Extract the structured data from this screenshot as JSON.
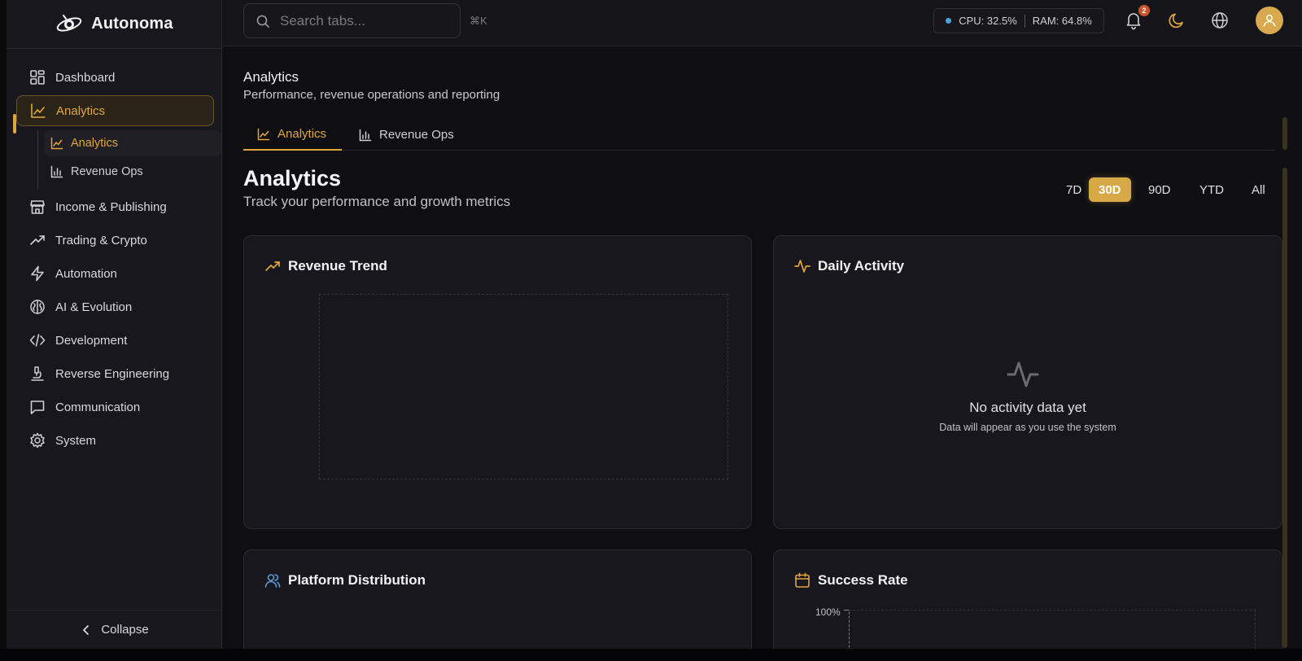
{
  "app": {
    "name": "Autonoma"
  },
  "sidebar": {
    "items": [
      {
        "label": "Dashboard",
        "icon": "dashboard-icon"
      },
      {
        "label": "Analytics",
        "icon": "line-chart-icon",
        "active": true
      },
      {
        "label": "Income & Publishing",
        "icon": "store-icon"
      },
      {
        "label": "Trading & Crypto",
        "icon": "trending-up-icon"
      },
      {
        "label": "Automation",
        "icon": "lightning-icon"
      },
      {
        "label": "AI & Evolution",
        "icon": "brain-icon"
      },
      {
        "label": "Development",
        "icon": "code-icon"
      },
      {
        "label": "Reverse Engineering",
        "icon": "microscope-icon"
      },
      {
        "label": "Communication",
        "icon": "message-icon"
      },
      {
        "label": "System",
        "icon": "gear-icon"
      }
    ],
    "subitems": [
      {
        "label": "Analytics",
        "icon": "line-chart-icon",
        "active": true
      },
      {
        "label": "Revenue Ops",
        "icon": "bar-chart-icon"
      }
    ],
    "collapse_label": "Collapse"
  },
  "topbar": {
    "search_placeholder": "Search tabs...",
    "shortcut": "⌘K",
    "cpu": "CPU: 32.5%",
    "ram": "RAM: 64.8%",
    "notification_count": "2",
    "accent_color": "#e3a63d"
  },
  "page": {
    "header_title": "Analytics",
    "header_subtitle": "Performance, revenue operations and reporting",
    "tabs": [
      {
        "label": "Analytics",
        "active": true
      },
      {
        "label": "Revenue Ops",
        "active": false
      }
    ],
    "title": "Analytics",
    "subtitle": "Track your performance and growth metrics",
    "ranges": [
      {
        "label": "7D",
        "active": false
      },
      {
        "label": "30D",
        "active": true
      },
      {
        "label": "90D",
        "active": false
      },
      {
        "label": "YTD",
        "active": false
      },
      {
        "label": "All",
        "active": false
      }
    ]
  },
  "cards": {
    "revenue_trend": {
      "title": "Revenue Trend"
    },
    "daily_activity": {
      "title": "Daily Activity",
      "empty_title": "No activity data yet",
      "empty_subtitle": "Data will appear as you use the system"
    },
    "platform_distribution": {
      "title": "Platform Distribution"
    },
    "success_rate": {
      "title": "Success Rate",
      "y_top_label": "100%"
    }
  }
}
